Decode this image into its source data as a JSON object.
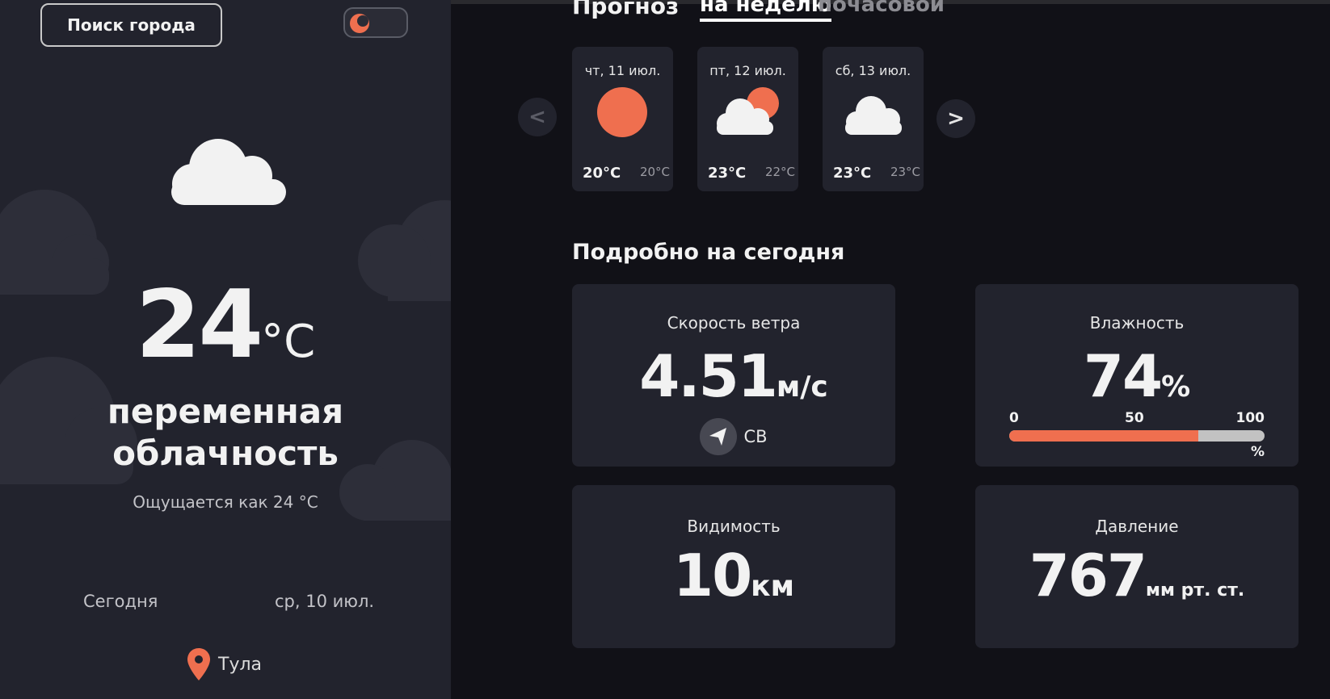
{
  "header": {
    "search_button": "Поиск города",
    "forecast_title": "Прогноз",
    "tab_week": "на неделю",
    "tab_hourly": "почасовой"
  },
  "current": {
    "temperature": "24",
    "temperature_unit": "°C",
    "description_line1": "переменная",
    "description_line2": "облачность",
    "feels_like": "Ощущается как 24 °C",
    "today_label": "Сегодня",
    "date": "ср, 10 июл.",
    "location": "Тула",
    "icon": "cloud-icon"
  },
  "forecast": {
    "prev_arrow": "<",
    "next_arrow": ">",
    "days": [
      {
        "label": "чт, 11 июл.",
        "max": "20°C",
        "min": "20°C",
        "icon": "sun-icon"
      },
      {
        "label": "пт, 12 июл.",
        "max": "23°C",
        "min": "22°C",
        "icon": "partly-cloudy-icon"
      },
      {
        "label": "сб, 13 июл.",
        "max": "23°C",
        "min": "23°C",
        "icon": "cloud-icon"
      }
    ]
  },
  "details": {
    "title": "Подробно на сегодня",
    "wind": {
      "title": "Скорость ветра",
      "value": "4.51",
      "unit": "м/с",
      "direction": "СВ",
      "icon": "wind-direction-icon"
    },
    "humidity": {
      "title": "Влажность",
      "value": "74",
      "unit": "%",
      "scale_min": "0",
      "scale_mid": "50",
      "scale_max": "100",
      "scale_unit": "%",
      "level": 0.74
    },
    "visibility": {
      "title": "Видимость",
      "value": "10",
      "unit": "км"
    },
    "pressure": {
      "title": "Давление",
      "value": "767",
      "unit": "мм рт. ст."
    }
  },
  "colors": {
    "accent": "#ef6f4f",
    "panel": "#22232d",
    "background": "#111117"
  }
}
